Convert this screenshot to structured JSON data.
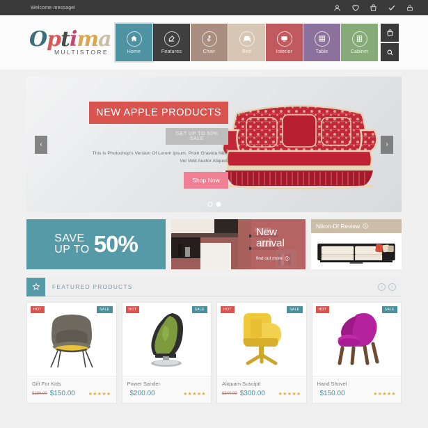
{
  "topbar": {
    "welcome": "Welcome message!",
    "icons": [
      {
        "name": "user-icon",
        "label": "Account"
      },
      {
        "name": "heart-icon",
        "label": "Wishlist"
      },
      {
        "name": "basket-icon",
        "label": "Cart"
      },
      {
        "name": "check-icon",
        "label": "Checkout"
      },
      {
        "name": "lock-icon",
        "label": "Login"
      }
    ]
  },
  "logo": {
    "letters": [
      "O",
      "p",
      "t",
      "i",
      "m",
      "a",
      ""
    ],
    "text": "Optima",
    "subtitle": "MULTISTORE"
  },
  "nav": {
    "items": [
      {
        "label": "Home",
        "icon": "home-icon",
        "color": "#4f93a3",
        "active": true
      },
      {
        "label": "Features",
        "icon": "edit-icon",
        "color": "#3f3f3f",
        "active": false
      },
      {
        "label": "Chair",
        "icon": "chair-icon",
        "color": "#a98e7f",
        "active": false
      },
      {
        "label": "Bed",
        "icon": "bed-icon",
        "color": "#d6c6b3",
        "active": false
      },
      {
        "label": "Interior",
        "icon": "monitor-icon",
        "color": "#c05a5e",
        "active": false
      },
      {
        "label": "Table",
        "icon": "table-icon",
        "color": "#8b719b",
        "active": false
      },
      {
        "label": "Cabinet",
        "icon": "cabinet-icon",
        "color": "#86ab78",
        "active": false
      }
    ],
    "side_buttons": [
      {
        "name": "cart-button",
        "icon": "basket-icon"
      },
      {
        "name": "search-button",
        "icon": "search-icon"
      }
    ]
  },
  "hero": {
    "title": "NEW APPLE PRODUCTS",
    "subtitle": "GET UP TO 50% SALE",
    "description": "This Is Photoshop's Version Of Lorem Ipsum. Proin Gravida Nibh Vel Velit Auctor Aliquet.",
    "button": "Shop Now",
    "prev_arrow": "‹",
    "next_arrow": "›",
    "slides": 2,
    "active_slide": 2
  },
  "promos": {
    "save": {
      "line1": "SAVE",
      "line2": "UP TO",
      "percent": "50%"
    },
    "new_arrival": {
      "line1": "New",
      "line2": "arrival",
      "link": "find out more"
    },
    "review": {
      "title": "Nikon-Df Review"
    }
  },
  "featured": {
    "title": "FEATURED PRODUCTS",
    "star_icon": "star-icon",
    "prev": "‹",
    "next": "›"
  },
  "products": [
    {
      "name": "Gift For Kids",
      "old_price": "$180.00",
      "price": "$150.00",
      "stars": "★★★★★",
      "badge_hot": "HOT",
      "badge_sale": "SALE",
      "color": "#6e6a60",
      "accent": "#e8c23a"
    },
    {
      "name": "Power Sander",
      "old_price": "",
      "price": "$200.00",
      "stars": "★★★★★",
      "badge_hot": "HOT",
      "badge_sale": "SALE",
      "color": "#7d9b3e",
      "accent": "#2a2a2a"
    },
    {
      "name": "Aliquam Suscipit",
      "old_price": "$340.00",
      "price": "$300.00",
      "stars": "★★★★★",
      "badge_hot": "HOT",
      "badge_sale": "SALE",
      "color": "#efc93c",
      "accent": "#c9a62c"
    },
    {
      "name": "Hand Shovel",
      "old_price": "",
      "price": "$150.00",
      "stars": "★★★★★",
      "badge_hot": "HOT",
      "badge_sale": "SALE",
      "color": "#b5229d",
      "accent": "#6d4a32"
    }
  ]
}
